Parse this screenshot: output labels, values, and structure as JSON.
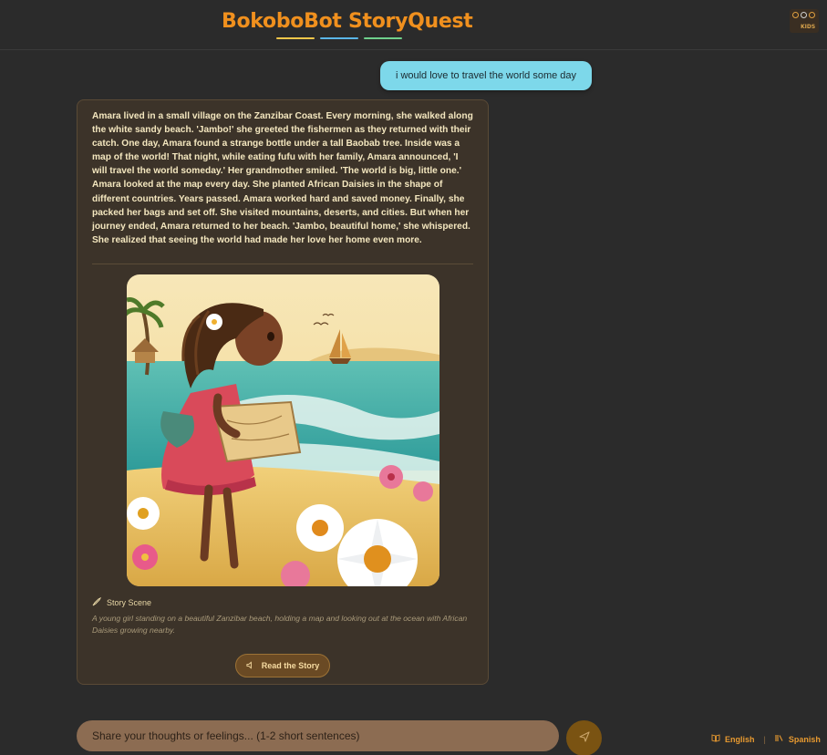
{
  "header": {
    "title": "BokoboBot StoryQuest",
    "underline_colors": [
      "#f5c74a",
      "#5ab6e8",
      "#6fd08c"
    ],
    "logo_badge": "KIDS"
  },
  "chat": {
    "user_message": "i would love to travel the world some day",
    "bot_story": "Amara lived in a small village on the Zanzibar Coast. Every morning, she walked along the white sandy beach. 'Jambo!' she greeted the fishermen as they returned with their catch. One day, Amara found a strange bottle under a tall Baobab tree. Inside was a map of the world! That night, while eating fufu with her family, Amara announced, 'I will travel the world someday.' Her grandmother smiled. 'The world is big, little one.' Amara looked at the map every day. She planted African Daisies in the shape of different countries. Years passed. Amara worked hard and saved money. Finally, she packed her bags and set off. She visited mountains, deserts, and cities. But when her journey ended, Amara returned to her beach. 'Jambo, beautiful home,' she whispered. She realized that seeing the world had made her love her home even more.",
    "scene_label": "Story Scene",
    "scene_description": "A young girl standing on a beautiful Zanzibar beach, holding a map and looking out at the ocean with African Daisies growing nearby.",
    "read_button_label": "Read the Story"
  },
  "composer": {
    "placeholder": "Share your thoughts or feelings... (1-2 short sentences)",
    "send_icon": "send-icon"
  },
  "languages": [
    "English",
    "Spanish"
  ],
  "colors": {
    "accent": "#f0901e",
    "user_bubble": "#7dd8ea",
    "bot_card": "#3c3329"
  }
}
